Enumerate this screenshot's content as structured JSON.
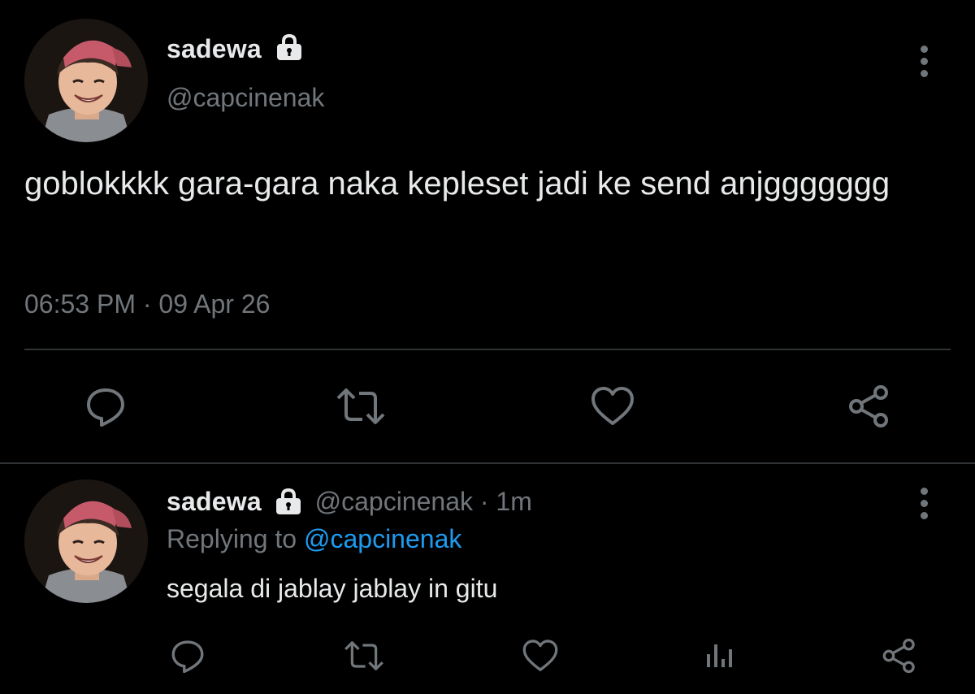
{
  "colors": {
    "background": "#000000",
    "primary_text": "#e7e9ea",
    "secondary_text": "#71767b",
    "link": "#1d9bf0",
    "divider": "#2f3336"
  },
  "main_tweet": {
    "display_name": "sadewa",
    "handle": "@capcinenak",
    "text": "goblokkkk gara-gara naka kepleset jadi ke send anjggggggg",
    "time": "06:53 PM",
    "separator": "·",
    "date": "09 Apr 26",
    "icons": [
      "lock-icon",
      "more-icon",
      "reply-icon",
      "retweet-icon",
      "like-icon",
      "share-icon"
    ]
  },
  "reply_tweet": {
    "display_name": "sadewa",
    "handle": "@capcinenak",
    "separator": "·",
    "age": "1m",
    "replying_prefix": "Replying to",
    "replying_handle": "@capcinenak",
    "text": "segala di jablay jablay in gitu",
    "icons": [
      "lock-icon",
      "more-icon",
      "reply-icon",
      "retweet-icon",
      "like-icon",
      "analytics-icon",
      "share-icon"
    ]
  }
}
